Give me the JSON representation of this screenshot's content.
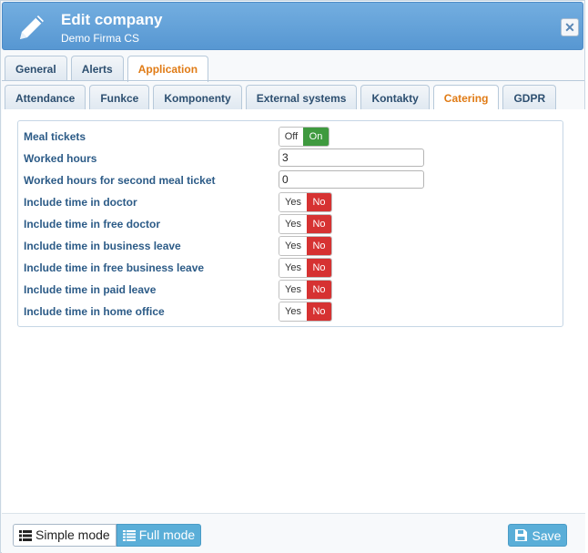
{
  "header": {
    "title": "Edit company",
    "subtitle": "Demo Firma CS",
    "close_glyph": "✕"
  },
  "tabs_primary": [
    {
      "label": "General"
    },
    {
      "label": "Alerts"
    },
    {
      "label": "Application",
      "active": true
    }
  ],
  "tabs_secondary": [
    {
      "label": "Attendance"
    },
    {
      "label": "Funkce"
    },
    {
      "label": "Komponenty"
    },
    {
      "label": "External systems"
    },
    {
      "label": "Kontakty"
    },
    {
      "label": "Catering",
      "active": true
    },
    {
      "label": "GDPR"
    }
  ],
  "form": {
    "meal_tickets": {
      "label": "Meal tickets",
      "off": "Off",
      "on": "On",
      "value": "On"
    },
    "worked_hours": {
      "label": "Worked hours",
      "value": "3"
    },
    "worked_hours_second": {
      "label": "Worked hours for second meal ticket",
      "value": "0"
    },
    "yes_label": "Yes",
    "no_label": "No",
    "toggles": [
      {
        "label": "Include time in doctor",
        "value": "No"
      },
      {
        "label": "Include time in free doctor",
        "value": "No"
      },
      {
        "label": "Include time in business leave",
        "value": "No"
      },
      {
        "label": "Include time in free business leave",
        "value": "No"
      },
      {
        "label": "Include time in paid leave",
        "value": "No"
      },
      {
        "label": "Include time in home office",
        "value": "No"
      }
    ]
  },
  "footer": {
    "simple_mode": "Simple mode",
    "full_mode": "Full mode",
    "save": "Save"
  },
  "colors": {
    "accent": "#5aaed8",
    "active_tab": "#e07b15",
    "on_green": "#3f9a3f",
    "no_red": "#d63232"
  }
}
